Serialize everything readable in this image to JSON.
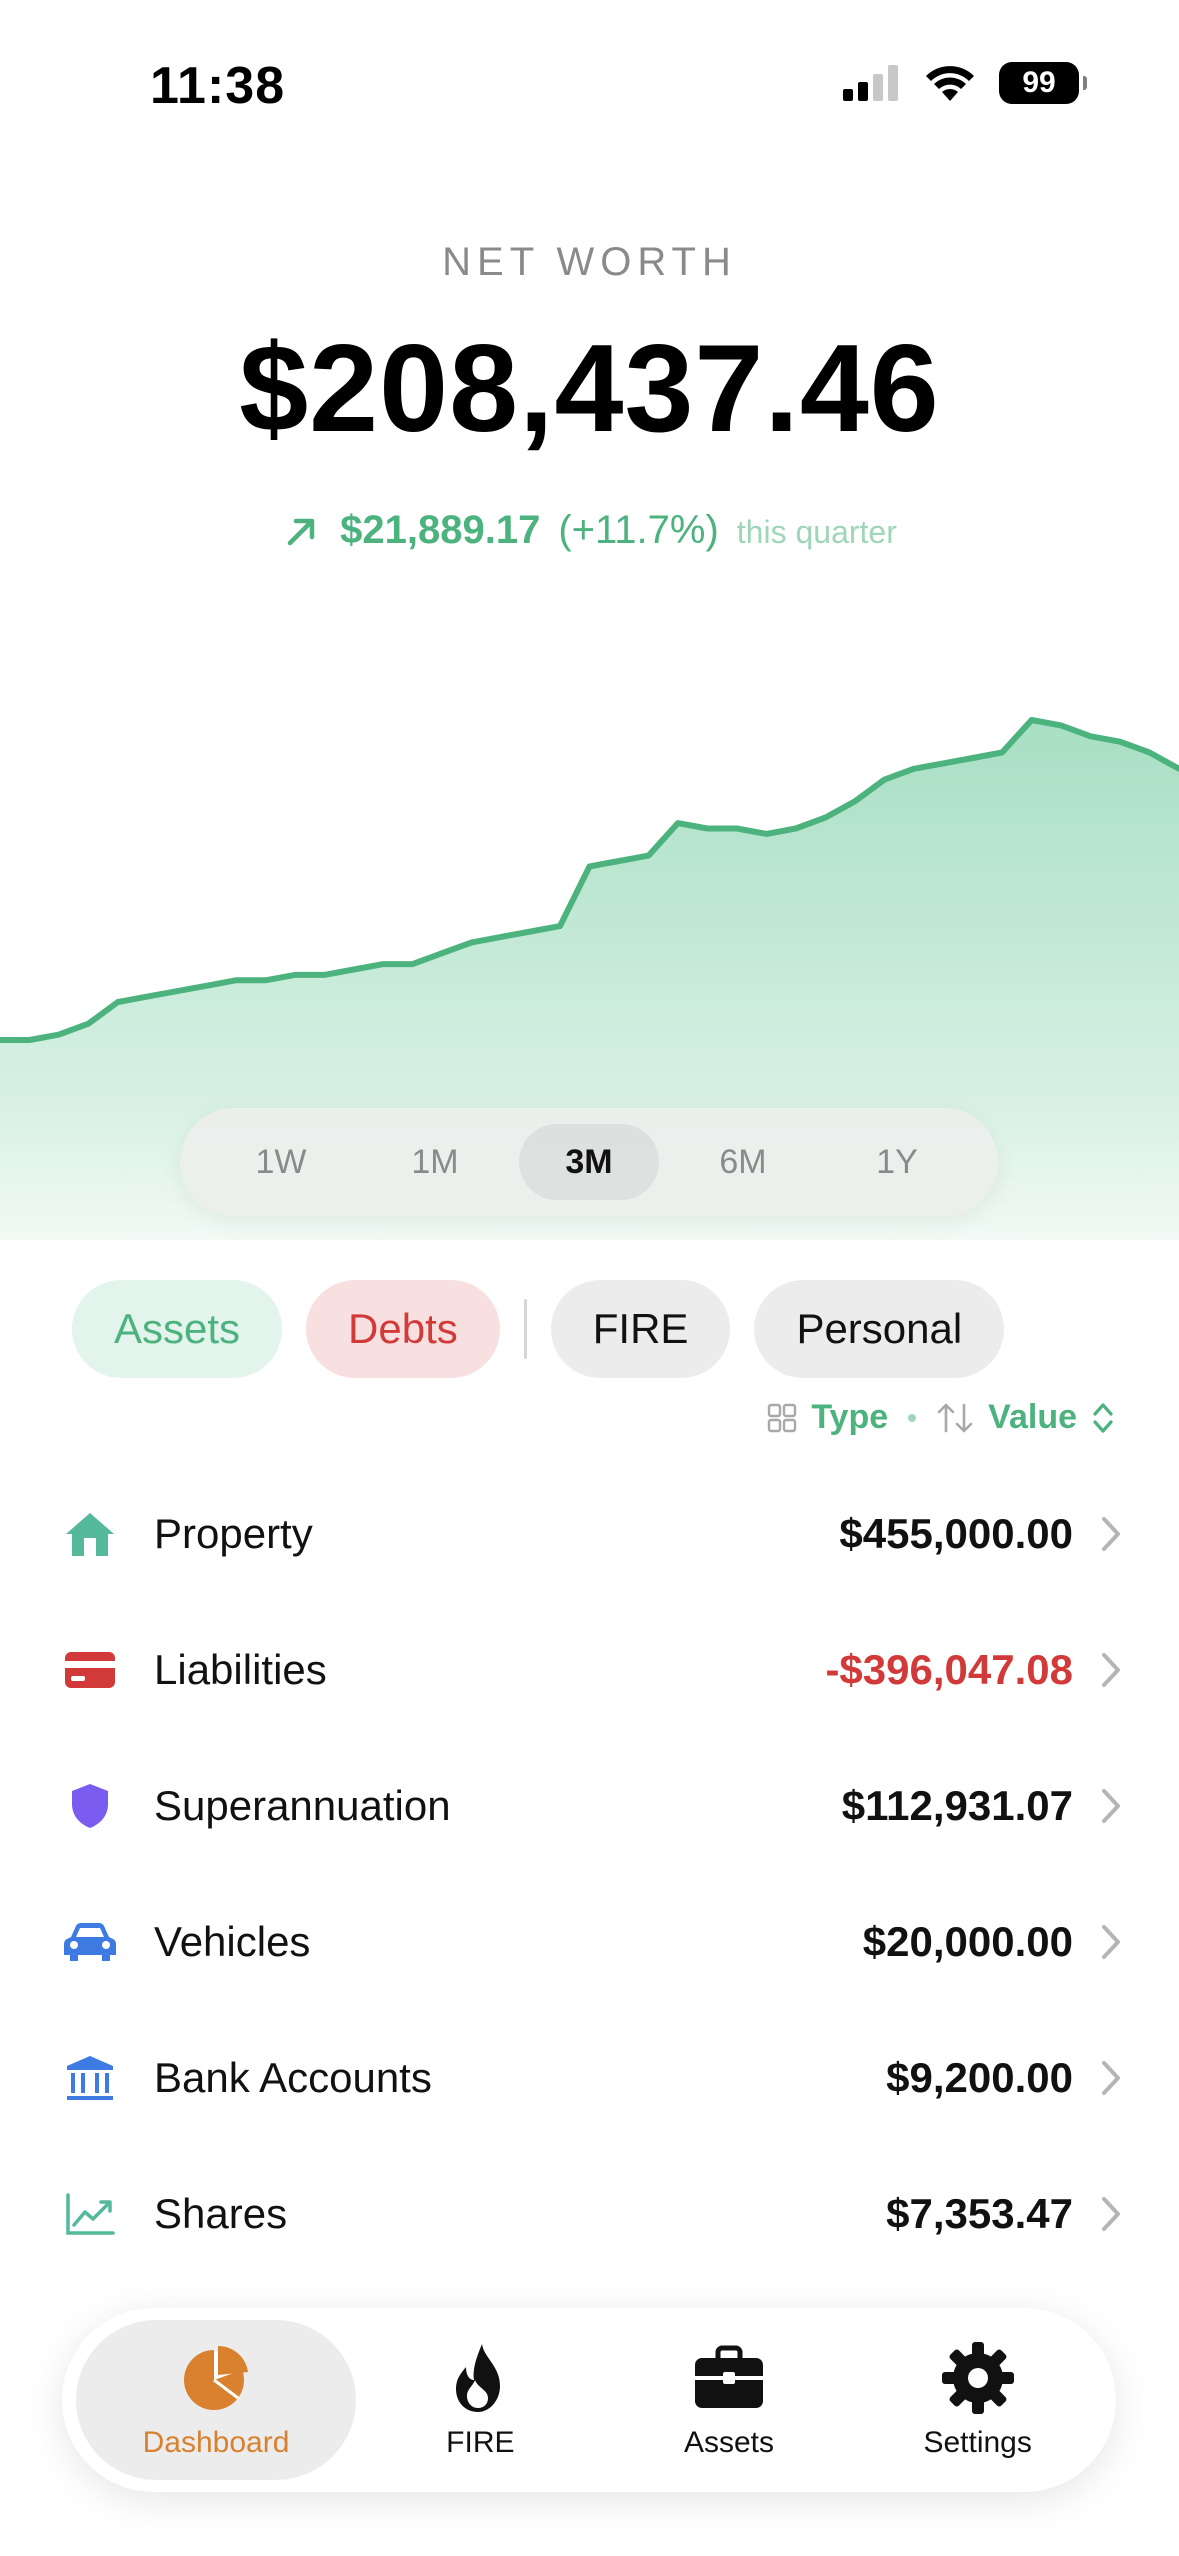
{
  "status_bar": {
    "time": "11:38",
    "battery": "99"
  },
  "header": {
    "label": "NET WORTH",
    "value": "$208,437.46",
    "change_amount": "$21,889.17",
    "change_percent": "(+11.7%)",
    "change_period": "this quarter"
  },
  "chart_data": {
    "type": "area",
    "series": [
      {
        "values": [
          150,
          150,
          151,
          153,
          157,
          158,
          159,
          160,
          161,
          161,
          162,
          162,
          163,
          164,
          164,
          166,
          168,
          169,
          170,
          171,
          182,
          183,
          184,
          190,
          189,
          189,
          188,
          189,
          191,
          194,
          198,
          200,
          201,
          202,
          203,
          209,
          208,
          206,
          205,
          203,
          200
        ]
      }
    ],
    "color": "#4cb37e",
    "fill": "#b5e3cc",
    "grid": false,
    "legend": "none"
  },
  "range_selector": {
    "options": [
      "1W",
      "1M",
      "3M",
      "6M",
      "1Y"
    ],
    "selected": "3M"
  },
  "filters": {
    "assets": "Assets",
    "debts": "Debts",
    "fire": "FIRE",
    "personal": "Personal"
  },
  "sort": {
    "group_label": "Type",
    "sort_label": "Value"
  },
  "categories": [
    {
      "label": "Property",
      "value": "$455,000.00",
      "icon": "house-icon",
      "color": "#4cb37e"
    },
    {
      "label": "Liabilities",
      "value": "-$396,047.08",
      "icon": "credit-card-icon",
      "color": "#d23a3a"
    },
    {
      "label": "Superannuation",
      "value": "$112,931.07",
      "icon": "shield-icon",
      "color": "#7b5cf0"
    },
    {
      "label": "Vehicles",
      "value": "$20,000.00",
      "icon": "car-icon",
      "color": "#3d7be3"
    },
    {
      "label": "Bank Accounts",
      "value": "$9,200.00",
      "icon": "bank-icon",
      "color": "#3d7be3"
    },
    {
      "label": "Shares",
      "value": "$7,353.47",
      "icon": "chart-line-icon",
      "color": "#4cb37e"
    }
  ],
  "tabs": [
    {
      "label": "Dashboard",
      "icon": "pie-chart-icon",
      "active": true
    },
    {
      "label": "FIRE",
      "icon": "flame-icon"
    },
    {
      "label": "Assets",
      "icon": "briefcase-icon"
    },
    {
      "label": "Settings",
      "icon": "gear-icon"
    }
  ],
  "colors": {
    "accent": "#4cb37e",
    "negative": "#d23a3a",
    "tab_active": "#d9812e"
  }
}
